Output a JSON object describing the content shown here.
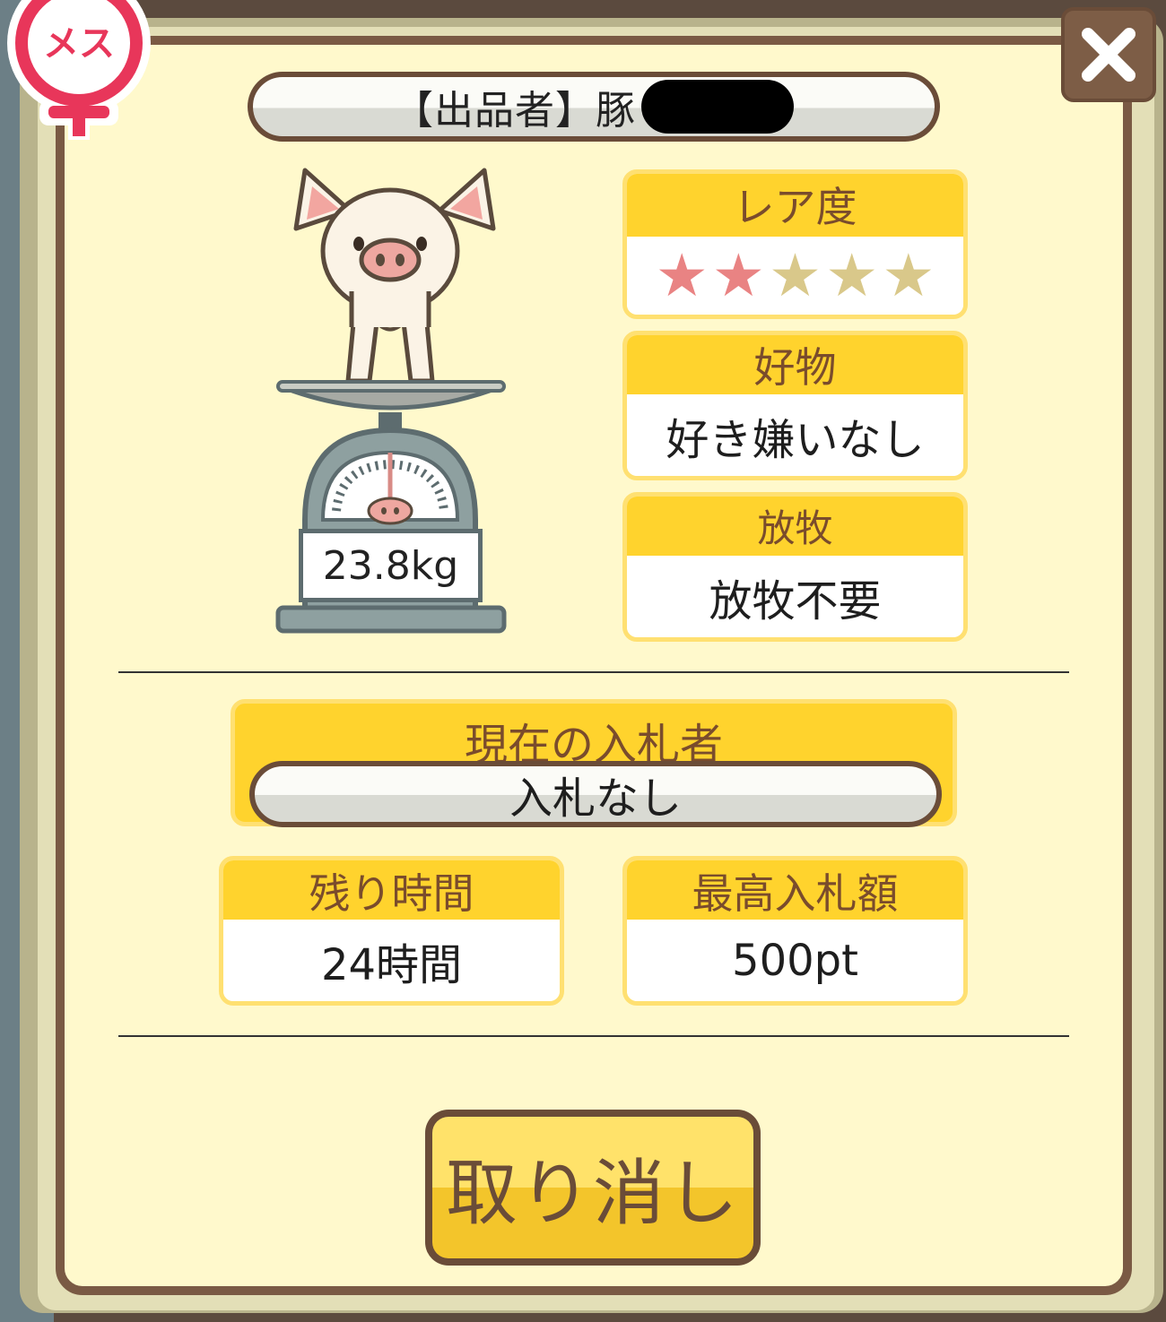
{
  "gender_badge": {
    "label": "メス"
  },
  "seller": {
    "label": "【出品者】豚"
  },
  "pig": {
    "weight": "23.8kg"
  },
  "rarity": {
    "title": "レア度",
    "stars_total": 5,
    "stars_filled": 2,
    "star_on_color": "#e98383",
    "star_off_color": "#d9c88a"
  },
  "favorite": {
    "title": "好物",
    "value": "好き嫌いなし"
  },
  "grazing": {
    "title": "放牧",
    "value": "放牧不要"
  },
  "bidder": {
    "title": "現在の入札者",
    "value": "入札なし"
  },
  "time_left": {
    "title": "残り時間",
    "value": "24時間"
  },
  "max_bid": {
    "title": "最高入札額",
    "value": "500pt"
  },
  "cancel_button": {
    "label": "取り消し"
  },
  "colors": {
    "panel_bg": "#fff9cc",
    "frame": "#7a5a44",
    "card_header": "#ffd32d",
    "header_text": "#7a4c2c"
  }
}
